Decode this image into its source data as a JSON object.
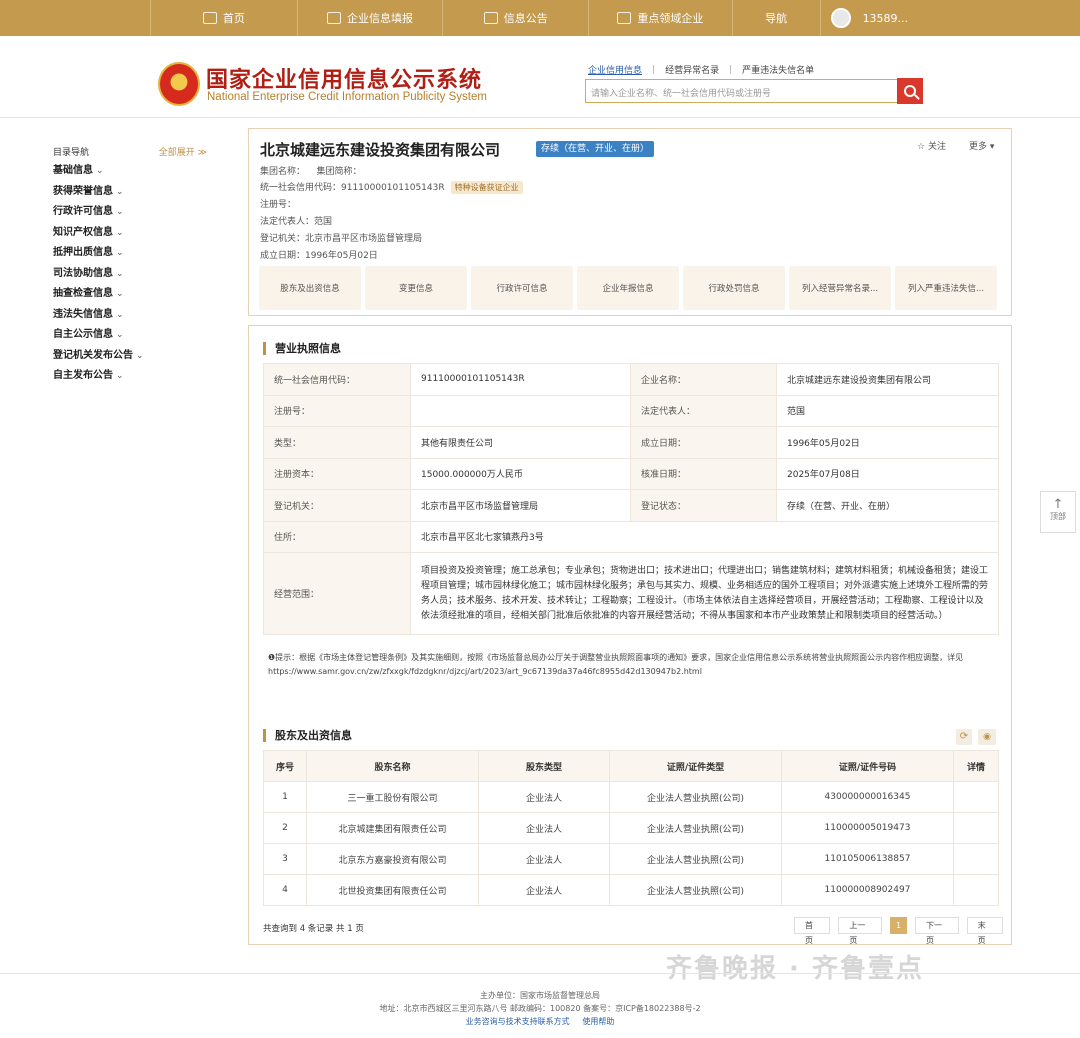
{
  "nav": {
    "home": "首页",
    "fill": "企业信息填报",
    "notice": "信息公告",
    "key_area": "重点领域企业",
    "guide": "导航",
    "user": "13589..."
  },
  "header": {
    "title_cn": "国家企业信用信息公示系统",
    "title_en": "National Enterprise Credit Information Publicity System",
    "search_tabs": [
      "企业信用信息",
      "经营异常名录",
      "严重违法失信名单"
    ],
    "search_placeholder": "请输入企业名称、统一社会信用代码或注册号"
  },
  "sidebar": {
    "title": "目录导航",
    "expand_all": "全部展开 ≫",
    "items": [
      "基础信息",
      "获得荣誉信息",
      "行政许可信息",
      "知识产权信息",
      "抵押出质信息",
      "司法协助信息",
      "抽查检查信息",
      "违法失信信息",
      "自主公示信息",
      "登记机关发布公告",
      "自主发布公告"
    ]
  },
  "company": {
    "name": "北京城建远东建设投资集团有限公司",
    "status": "存续（在营、开业、在册）",
    "follow": "关注",
    "more": "更多",
    "group_name_label": "集团名称：",
    "group_abbr_label": "集团简称：",
    "credit_code_line": "统一社会信用代码：91110000101105143R",
    "special_tag": "特种设备获证企业",
    "reg_no_line": "注册号：",
    "legal_rep_line": "法定代表人：范国",
    "authority_line": "登记机关：北京市昌平区市场监督管理局",
    "date_line": "成立日期：1996年05月02日",
    "tabs": [
      "股东及出资信息",
      "变更信息",
      "行政许可信息",
      "企业年报信息",
      "行政处罚信息",
      "列入经营异常名录...",
      "列入严重违法失信..."
    ]
  },
  "license": {
    "title": "营业执照信息",
    "rows": [
      [
        "统一社会信用代码：",
        "91110000101105143R",
        "企业名称：",
        "北京城建远东建设投资集团有限公司"
      ],
      [
        "注册号：",
        "",
        "法定代表人：",
        "范国"
      ],
      [
        "类型：",
        "其他有限责任公司",
        "成立日期：",
        "1996年05月02日"
      ],
      [
        "注册资本：",
        "15000.000000万人民币",
        "核准日期：",
        "2025年07月08日"
      ],
      [
        "登记机关：",
        "北京市昌平区市场监督管理局",
        "登记状态：",
        "存续（在营、开业、在册）"
      ]
    ],
    "address_label": "住所：",
    "address": "北京市昌平区北七家镇燕丹3号",
    "scope_label": "经营范围：",
    "scope": "项目投资及投资管理；施工总承包；专业承包；货物进出口；技术进出口；代理进出口；销售建筑材料；建筑材料租赁；机械设备租赁；建设工程项目管理；城市园林绿化施工；城市园林绿化服务；承包与其实力、规模、业务相适应的国外工程项目；对外派遣实施上述境外工程所需的劳务人员；技术服务、技术开发、技术转让；工程勘察；工程设计。（市场主体依法自主选择经营项目，开展经营活动；工程勘察、工程设计以及依法须经批准的项目，经相关部门批准后依批准的内容开展经营活动；不得从事国家和本市产业政策禁止和限制类项目的经营活动。）",
    "notice": "❶提示：根据《市场主体登记管理条例》及其实施细则，按照《市场监督总局办公厅关于调整营业执照照面事项的通知》要求，国家企业信用信息公示系统将营业执照照面公示内容作相应调整，详见 https://www.samr.gov.cn/zw/zfxxgk/fdzdgknr/djzcj/art/2023/art_9c67139da37a46fc8955d42d130947b2.html"
  },
  "shareholders": {
    "title": "股东及出资信息",
    "headers": [
      "序号",
      "股东名称",
      "股东类型",
      "证照/证件类型",
      "证照/证件号码",
      "详情"
    ],
    "rows": [
      [
        "1",
        "三一重工股份有限公司",
        "企业法人",
        "企业法人营业执照(公司)",
        "430000000016345",
        ""
      ],
      [
        "2",
        "北京城建集团有限责任公司",
        "企业法人",
        "企业法人营业执照(公司)",
        "110000005019473",
        ""
      ],
      [
        "3",
        "北京东方嘉豪投资有限公司",
        "企业法人",
        "企业法人营业执照(公司)",
        "110105006138857",
        ""
      ],
      [
        "4",
        "北世投资集团有限责任公司",
        "企业法人",
        "企业法人营业执照(公司)",
        "110000008902497",
        ""
      ]
    ],
    "total": "共查询到 4 条记录 共 1 页",
    "pager": {
      "first": "首页",
      "prev": "上一页",
      "current": "1",
      "next": "下一页",
      "last": "末页"
    }
  },
  "to_top": "顶部",
  "footer": {
    "sponsor": "主办单位：国家市场监督管理总局",
    "address": "地址：北京市西城区三里河东路八号   邮政编码：100820   备案号：京ICP备18022388号-2",
    "support": "业务咨询与技术支持联系方式",
    "help": "使用帮助"
  },
  "watermark": "齐鲁晚报 · 齐鲁壹点"
}
